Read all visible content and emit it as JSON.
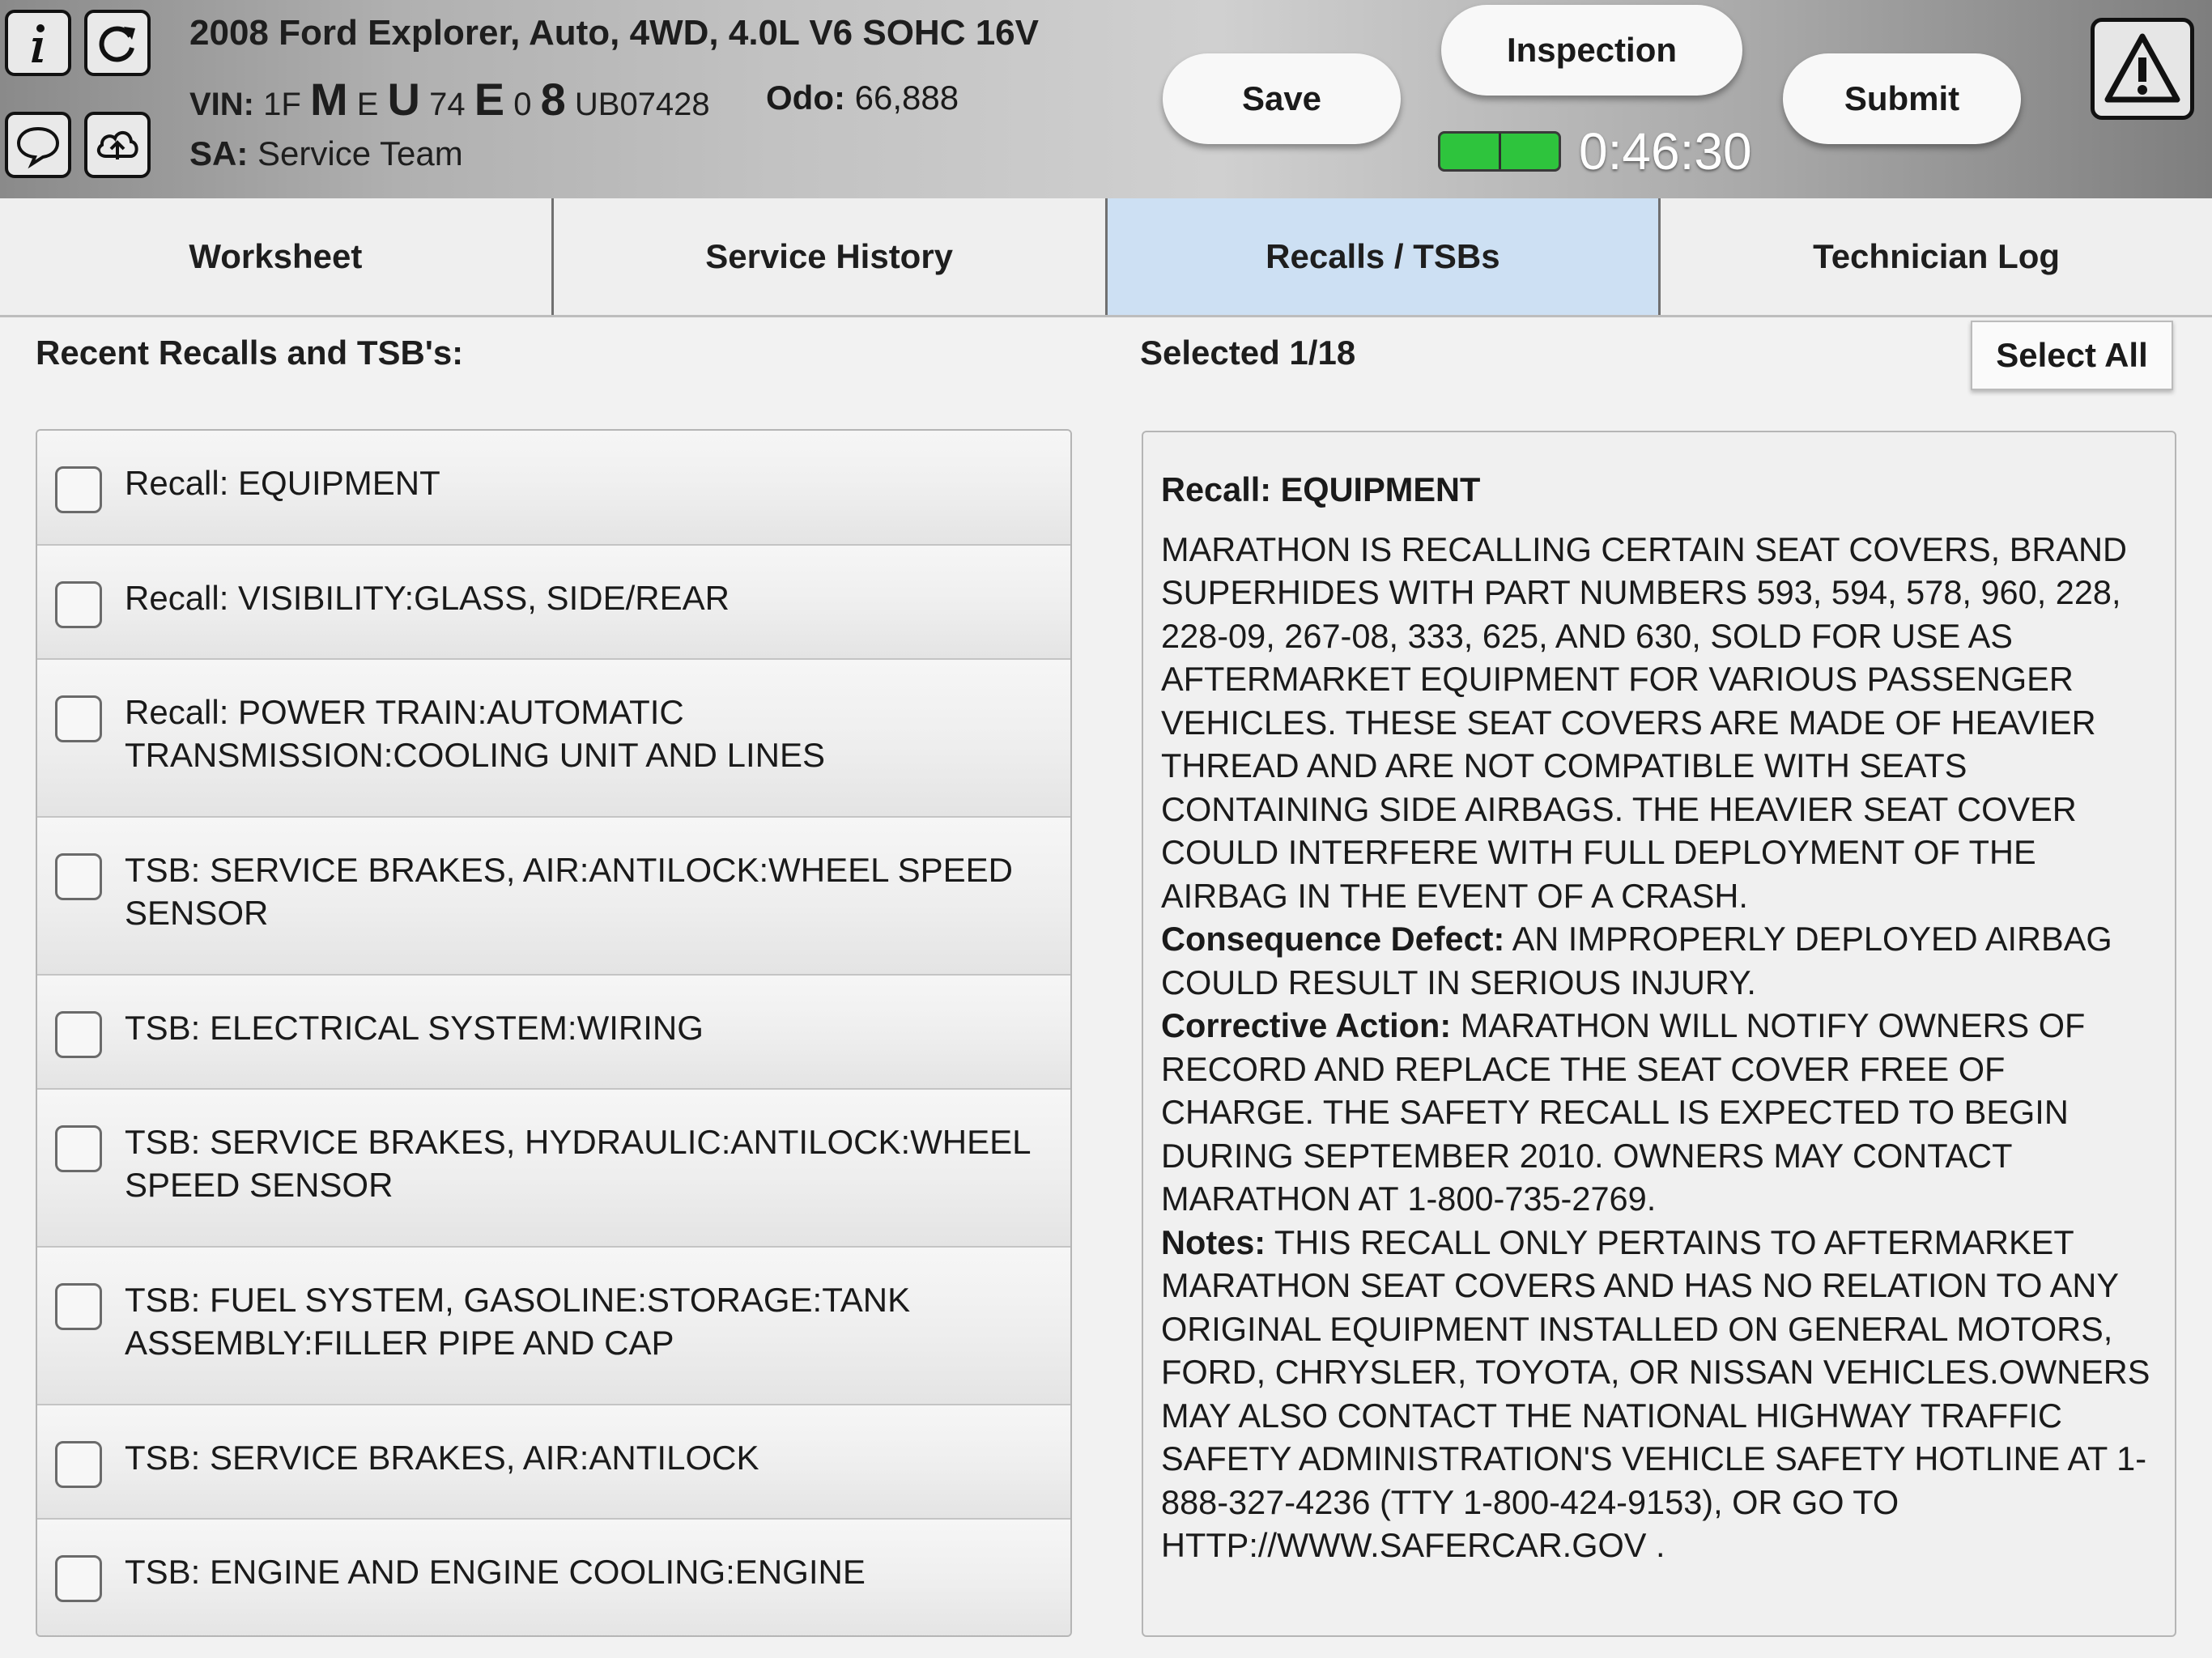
{
  "vehicle": {
    "title": "2008 Ford Explorer, Auto, 4WD, 4.0L V6 SOHC 16V",
    "vin_label": "VIN:",
    "vin_parts": [
      "1F",
      "M",
      "E",
      "U",
      "74",
      "E",
      "0",
      "8",
      "UB07428"
    ],
    "odo_label": "Odo:",
    "odo_value": "66,888",
    "sa_label": "SA:",
    "sa_value": "Service Team"
  },
  "header": {
    "icons": [
      "info-icon",
      "refresh-icon",
      "chat-icon",
      "cloud-upload-icon",
      "warning-icon"
    ],
    "save_label": "Save",
    "inspection_label": "Inspection",
    "submit_label": "Submit",
    "timer": "0:46:30",
    "timer_color": "#2ec43d"
  },
  "tabs": [
    {
      "label": "Worksheet",
      "active": false
    },
    {
      "label": "Service History",
      "active": false
    },
    {
      "label": "Recalls / TSBs",
      "active": true
    },
    {
      "label": "Technician Log",
      "active": false
    }
  ],
  "recalls": {
    "heading": "Recent Recalls and TSB's:",
    "selected_text": "Selected 1/18",
    "select_all_label": "Select All",
    "items": [
      {
        "label": "Recall: EQUIPMENT",
        "checked": false
      },
      {
        "label": "Recall: VISIBILITY:GLASS, SIDE/REAR",
        "checked": false
      },
      {
        "label": "Recall: POWER TRAIN:AUTOMATIC TRANSMISSION:COOLING UNIT AND LINES",
        "checked": false
      },
      {
        "label": "TSB: SERVICE BRAKES, AIR:ANTILOCK:WHEEL SPEED SENSOR",
        "checked": false
      },
      {
        "label": "TSB: ELECTRICAL SYSTEM:WIRING",
        "checked": false
      },
      {
        "label": "TSB: SERVICE BRAKES, HYDRAULIC:ANTILOCK:WHEEL SPEED SENSOR",
        "checked": false
      },
      {
        "label": "TSB: FUEL SYSTEM, GASOLINE:STORAGE:TANK ASSEMBLY:FILLER PIPE AND CAP",
        "checked": false
      },
      {
        "label": "TSB: SERVICE BRAKES, AIR:ANTILOCK",
        "checked": false
      },
      {
        "label": "TSB: ENGINE AND ENGINE COOLING:ENGINE",
        "checked": false
      }
    ]
  },
  "detail": {
    "title": "Recall: EQUIPMENT",
    "summary": "MARATHON IS RECALLING CERTAIN SEAT COVERS, BRAND SUPERHIDES WITH PART NUMBERS 593, 594, 578, 960, 228, 228-09, 267-08, 333, 625, AND 630, SOLD FOR USE AS AFTERMARKET EQUIPMENT FOR VARIOUS PASSENGER VEHICLES. THESE SEAT COVERS ARE MADE OF HEAVIER THREAD AND ARE NOT COMPATIBLE WITH SEATS CONTAINING SIDE AIRBAGS. THE HEAVIER SEAT COVER COULD INTERFERE WITH FULL DEPLOYMENT OF THE AIRBAG IN THE EVENT OF A CRASH.",
    "consequence_label": "Consequence Defect:",
    "consequence": "AN IMPROPERLY DEPLOYED AIRBAG COULD RESULT IN SERIOUS INJURY.",
    "corrective_label": "Corrective Action:",
    "corrective": "MARATHON WILL NOTIFY OWNERS OF RECORD AND REPLACE THE SEAT COVER FREE OF CHARGE. THE SAFETY RECALL IS EXPECTED TO BEGIN DURING SEPTEMBER 2010. OWNERS MAY CONTACT MARATHON AT 1-800-735-2769.",
    "notes_label": "Notes:",
    "notes": "THIS RECALL ONLY PERTAINS TO AFTERMARKET MARATHON SEAT COVERS AND HAS NO RELATION TO ANY ORIGINAL EQUIPMENT INSTALLED ON GENERAL MOTORS, FORD, CHRYSLER, TOYOTA, OR NISSAN VEHICLES.OWNERS MAY ALSO CONTACT THE NATIONAL HIGHWAY TRAFFIC SAFETY ADMINISTRATION'S VEHICLE SAFETY HOTLINE AT 1-888-327-4236 (TTY 1-800-424-9153), OR GO TO HTTP://WWW.SAFERCAR.GOV ."
  }
}
